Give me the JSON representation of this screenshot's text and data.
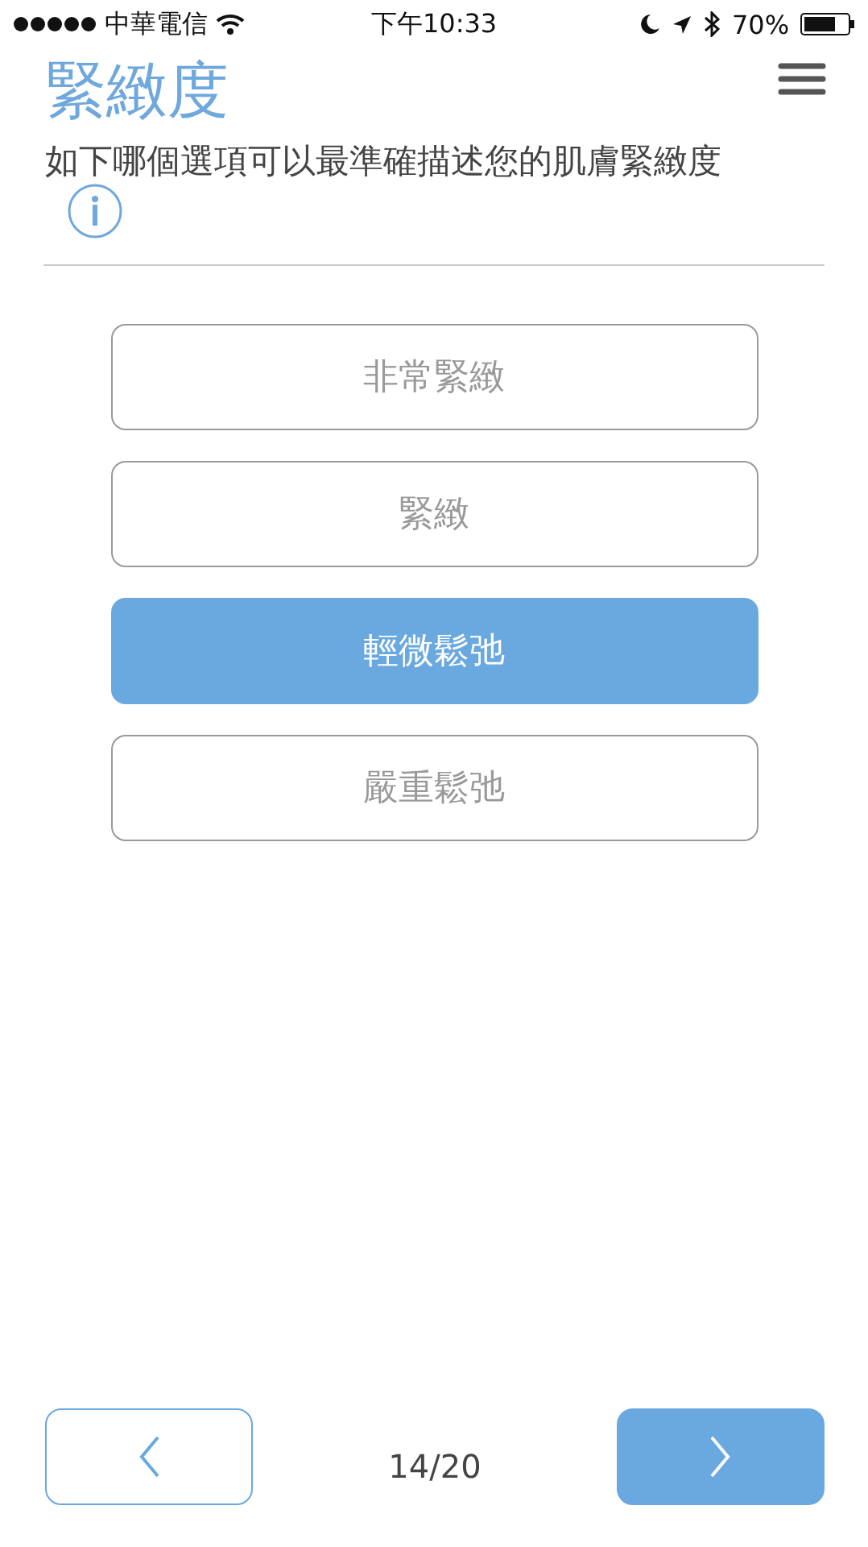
{
  "status_bar": {
    "carrier": "中華電信",
    "time": "下午10:33",
    "battery": "70%"
  },
  "header": {
    "title": "緊緻度"
  },
  "question": {
    "text": "如下哪個選項可以最準確描述您的肌膚緊緻度"
  },
  "options": [
    {
      "label": "非常緊緻",
      "selected": false
    },
    {
      "label": "緊緻",
      "selected": false
    },
    {
      "label": "輕微鬆弛",
      "selected": true
    },
    {
      "label": "嚴重鬆弛",
      "selected": false
    }
  ],
  "footer": {
    "progress": "14/20"
  }
}
